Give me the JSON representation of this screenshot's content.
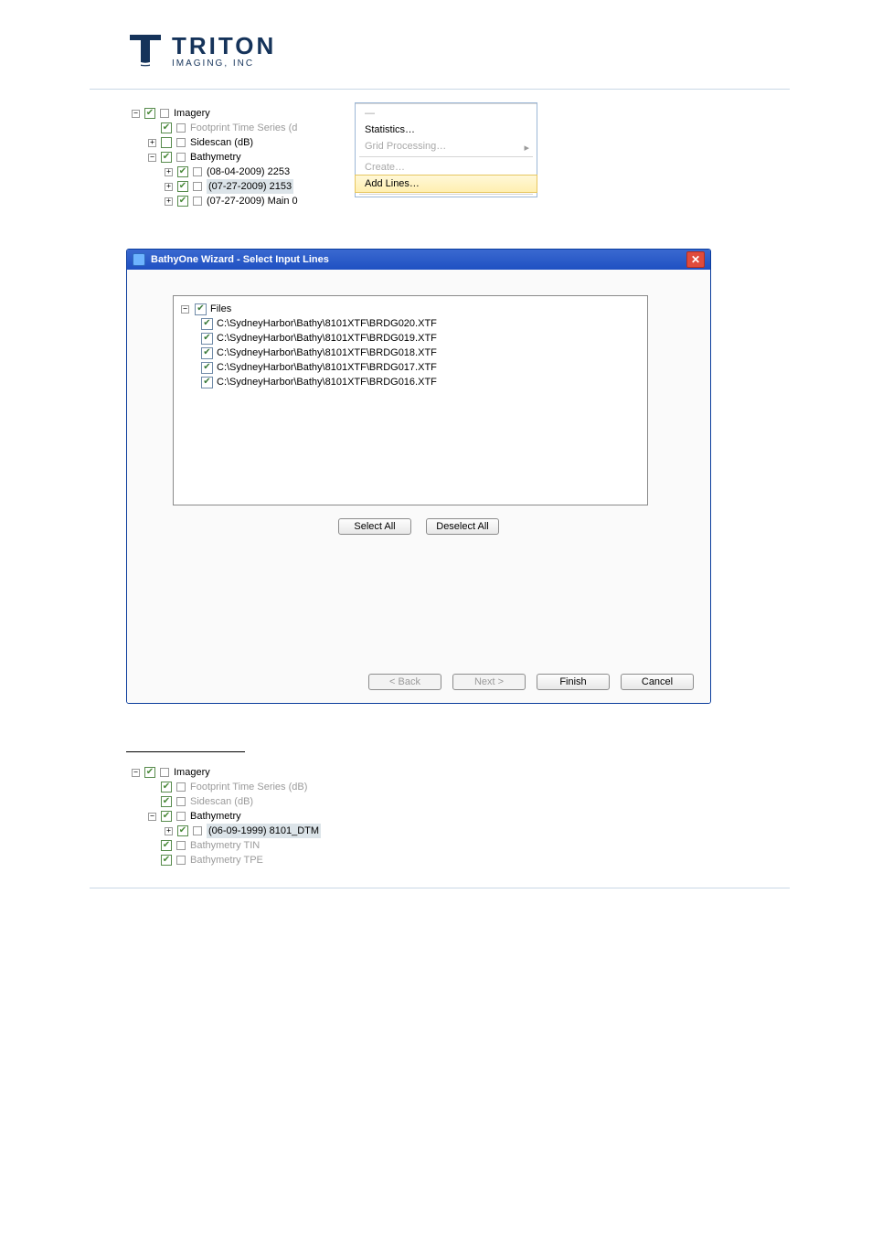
{
  "logo": {
    "main": "TRITON",
    "sub": "IMAGING, INC"
  },
  "tree1": {
    "root": "Imagery",
    "items": [
      {
        "label": "Footprint Time Series (d",
        "checked": true,
        "dim": true,
        "expander": null,
        "indent": 1
      },
      {
        "label": "Sidescan (dB)",
        "checked": false,
        "dim": false,
        "expander": "+",
        "indent": 1
      },
      {
        "label": "Bathymetry",
        "checked": true,
        "dim": false,
        "expander": "-",
        "indent": 1
      },
      {
        "label": "(08-04-2009) 2253",
        "checked": true,
        "dim": false,
        "expander": "+",
        "indent": 2
      },
      {
        "label": "(07-27-2009) 2153",
        "checked": true,
        "dim": false,
        "expander": "+",
        "indent": 2,
        "selected": true
      },
      {
        "label": "(07-27-2009) Main 0",
        "checked": true,
        "dim": false,
        "expander": "+",
        "indent": 2
      }
    ]
  },
  "ctx": {
    "stats": "Statistics…",
    "grid": "Grid Processing…",
    "create": "Create…",
    "addlines": "Add Lines…"
  },
  "dialog": {
    "title": "BathyOne Wizard - Select Input Lines",
    "root": "Files",
    "files": [
      "C:\\SydneyHarbor\\Bathy\\8101XTF\\BRDG020.XTF",
      "C:\\SydneyHarbor\\Bathy\\8101XTF\\BRDG019.XTF",
      "C:\\SydneyHarbor\\Bathy\\8101XTF\\BRDG018.XTF",
      "C:\\SydneyHarbor\\Bathy\\8101XTF\\BRDG017.XTF",
      "C:\\SydneyHarbor\\Bathy\\8101XTF\\BRDG016.XTF"
    ],
    "select_all": "Select All",
    "deselect_all": "Deselect All",
    "back": "< Back",
    "next": "Next >",
    "finish": "Finish",
    "cancel": "Cancel"
  },
  "tree2": {
    "root": "Imagery",
    "items": [
      {
        "label": "Footprint Time Series (dB)",
        "checked": true,
        "dim": true,
        "expander": null,
        "indent": 1
      },
      {
        "label": "Sidescan (dB)",
        "checked": true,
        "dim": true,
        "expander": null,
        "indent": 1
      },
      {
        "label": "Bathymetry",
        "checked": true,
        "dim": false,
        "expander": "-",
        "indent": 1
      },
      {
        "label": "(06-09-1999) 8101_DTM",
        "checked": true,
        "dim": false,
        "expander": "+",
        "indent": 2,
        "selected": true
      },
      {
        "label": "Bathymetry TIN",
        "checked": true,
        "dim": true,
        "expander": null,
        "indent": 1
      },
      {
        "label": "Bathymetry TPE",
        "checked": true,
        "dim": true,
        "expander": null,
        "indent": 1
      }
    ]
  }
}
